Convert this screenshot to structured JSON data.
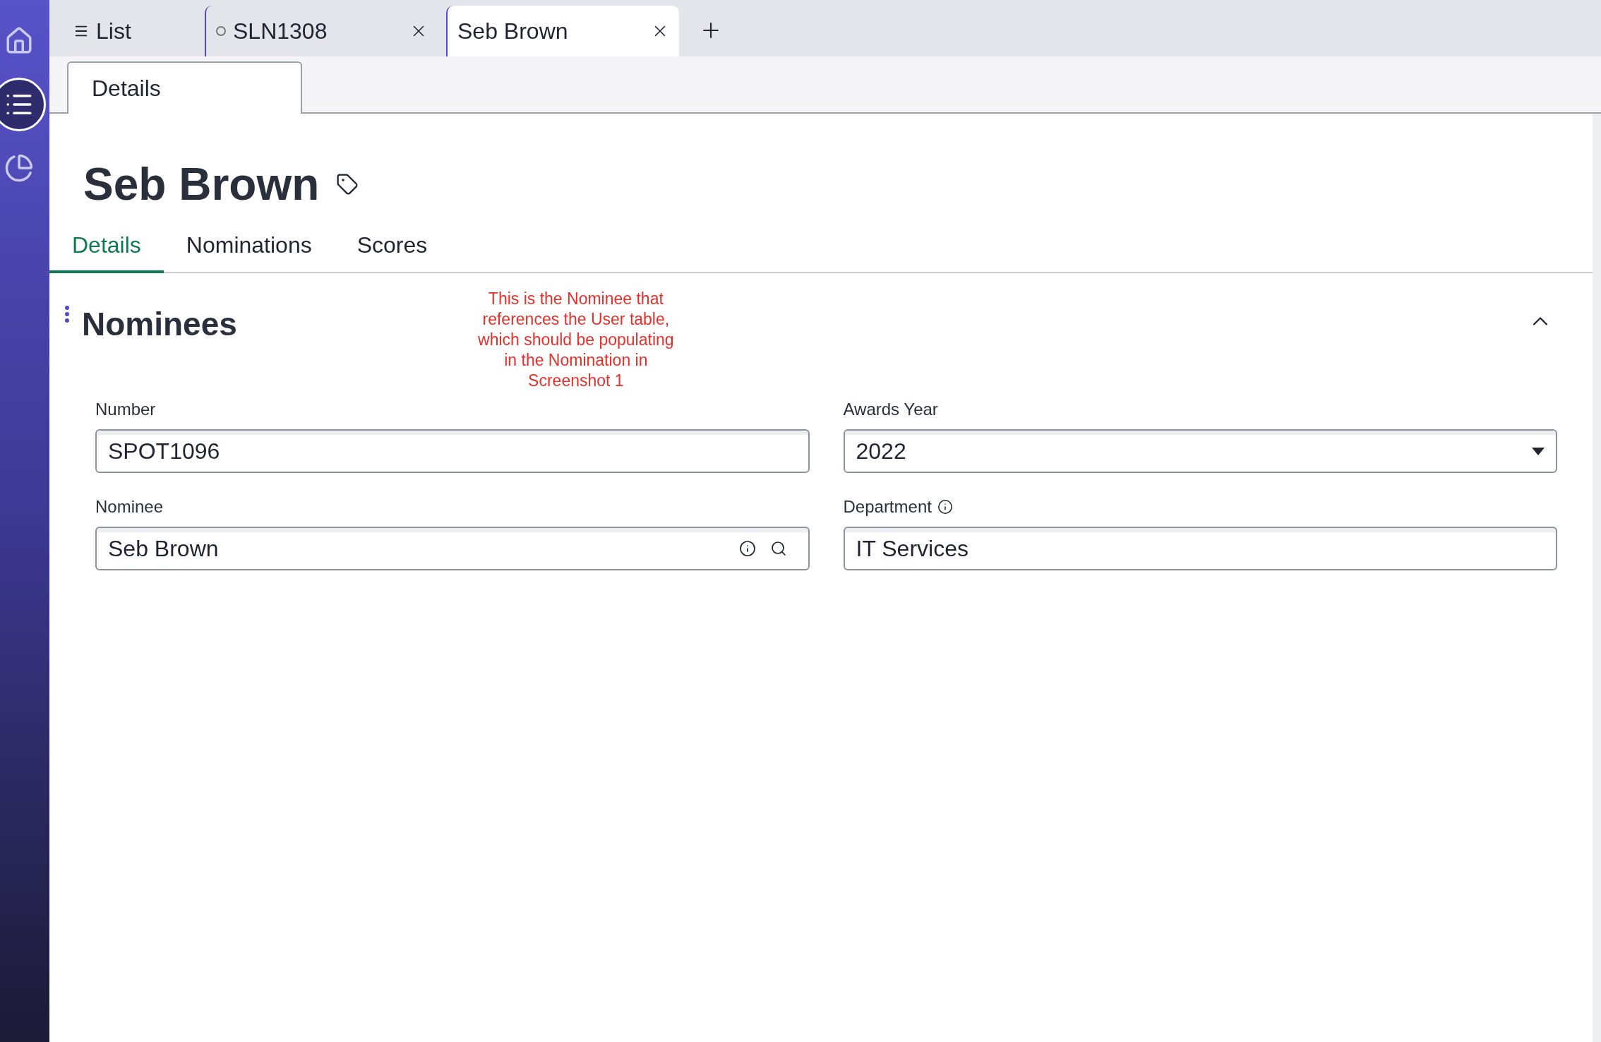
{
  "sidebar": {
    "items": [
      {
        "kind": "home",
        "selected": false
      },
      {
        "kind": "list",
        "selected": true
      },
      {
        "kind": "analytics",
        "selected": false
      }
    ]
  },
  "workspace_tabs": [
    {
      "kind": "list",
      "label": "List",
      "selected": false,
      "closable": false
    },
    {
      "kind": "record",
      "label": "SLN1308",
      "selected": false,
      "closable": true
    },
    {
      "kind": "record",
      "label": "Seb Brown",
      "selected": true,
      "closable": true
    }
  ],
  "form_tabs": [
    {
      "label": "Details",
      "selected": true
    }
  ],
  "record": {
    "title": "Seb Brown"
  },
  "section_tabs": [
    {
      "label": "Details",
      "selected": true
    },
    {
      "label": "Nominations",
      "selected": false
    },
    {
      "label": "Scores",
      "selected": false
    }
  ],
  "section": {
    "title": "Nominees",
    "expanded": true,
    "annotation": "This is the Nominee that references the User table, which should be populating in the Nomination in Screenshot 1"
  },
  "fields": [
    {
      "kind": "text",
      "label": "Number",
      "value": "SPOT1096",
      "info": false
    },
    {
      "kind": "select",
      "label": "Awards Year",
      "value": "2022",
      "info": false
    },
    {
      "kind": "reference",
      "label": "Nominee",
      "value": "Seb Brown",
      "info": false
    },
    {
      "kind": "text",
      "label": "Department",
      "value": "IT Services",
      "info": true
    }
  ]
}
